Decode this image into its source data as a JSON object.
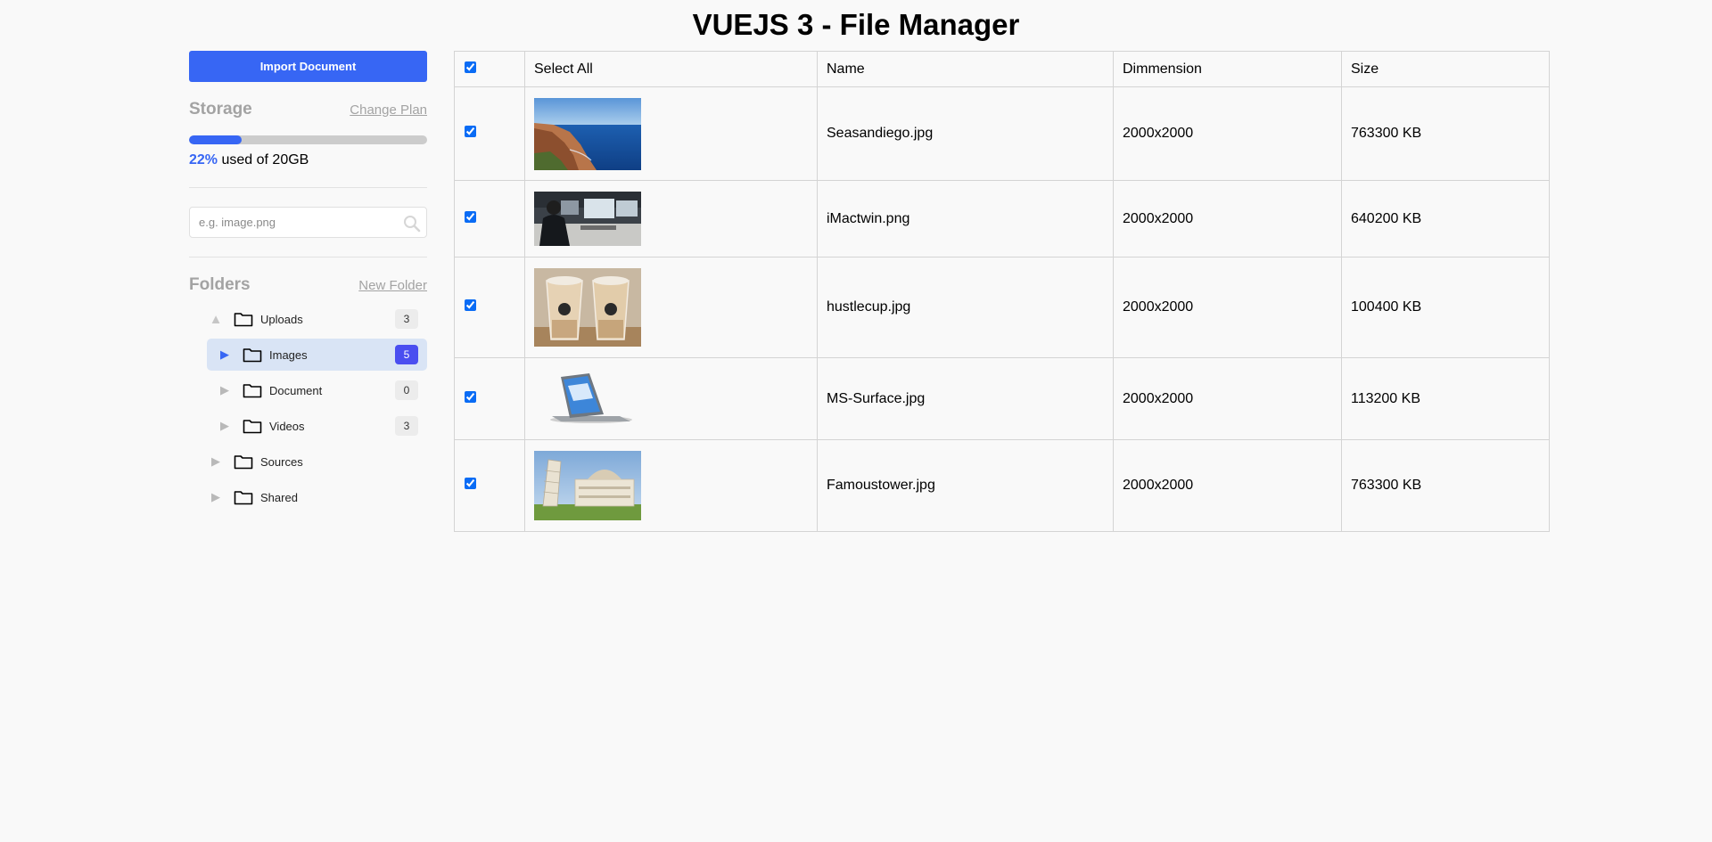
{
  "page": {
    "title": "VUEJS 3 - File Manager"
  },
  "sidebar": {
    "import_label": "Import Document",
    "storage": {
      "title": "Storage",
      "change_plan_label": "Change Plan",
      "used_percent_label": "22%",
      "used_fraction": 0.22,
      "used_suffix": "used of 20GB"
    },
    "search": {
      "placeholder": "e.g. image.png",
      "value": ""
    },
    "folders": {
      "title": "Folders",
      "new_folder_label": "New Folder",
      "items": [
        {
          "label": "Uploads",
          "count": "3"
        },
        {
          "label": "Images",
          "count": "5"
        },
        {
          "label": "Document",
          "count": "0"
        },
        {
          "label": "Videos",
          "count": "3"
        },
        {
          "label": "Sources"
        },
        {
          "label": "Shared"
        }
      ]
    }
  },
  "table": {
    "headers": {
      "select_all": "Select All",
      "name": "Name",
      "dimension": "Dimmension",
      "size": "Size"
    },
    "rows": [
      {
        "name": "Seasandiego.jpg",
        "dimension": "2000x2000",
        "size": "763300 KB",
        "image": "coastal-cliff-ocean-photo"
      },
      {
        "name": "iMactwin.png",
        "dimension": "2000x2000",
        "size": "640200 KB",
        "image": "man-at-desk-with-monitors-photo"
      },
      {
        "name": "hustlecup.jpg",
        "dimension": "2000x2000",
        "size": "100400 KB",
        "image": "two-iced-coffee-cups-photo"
      },
      {
        "name": "MS-Surface.jpg",
        "dimension": "2000x2000",
        "size": "113200 KB",
        "image": "surface-laptop-tablet-photo"
      },
      {
        "name": "Famoustower.jpg",
        "dimension": "2000x2000",
        "size": "763300 KB",
        "image": "leaning-tower-of-pisa-photo"
      }
    ]
  },
  "colors": {
    "accent": "#3766f4",
    "badge_selected": "#4a4ef0",
    "selected_row": "#d9e4f5",
    "background": "#f9f9f9"
  }
}
